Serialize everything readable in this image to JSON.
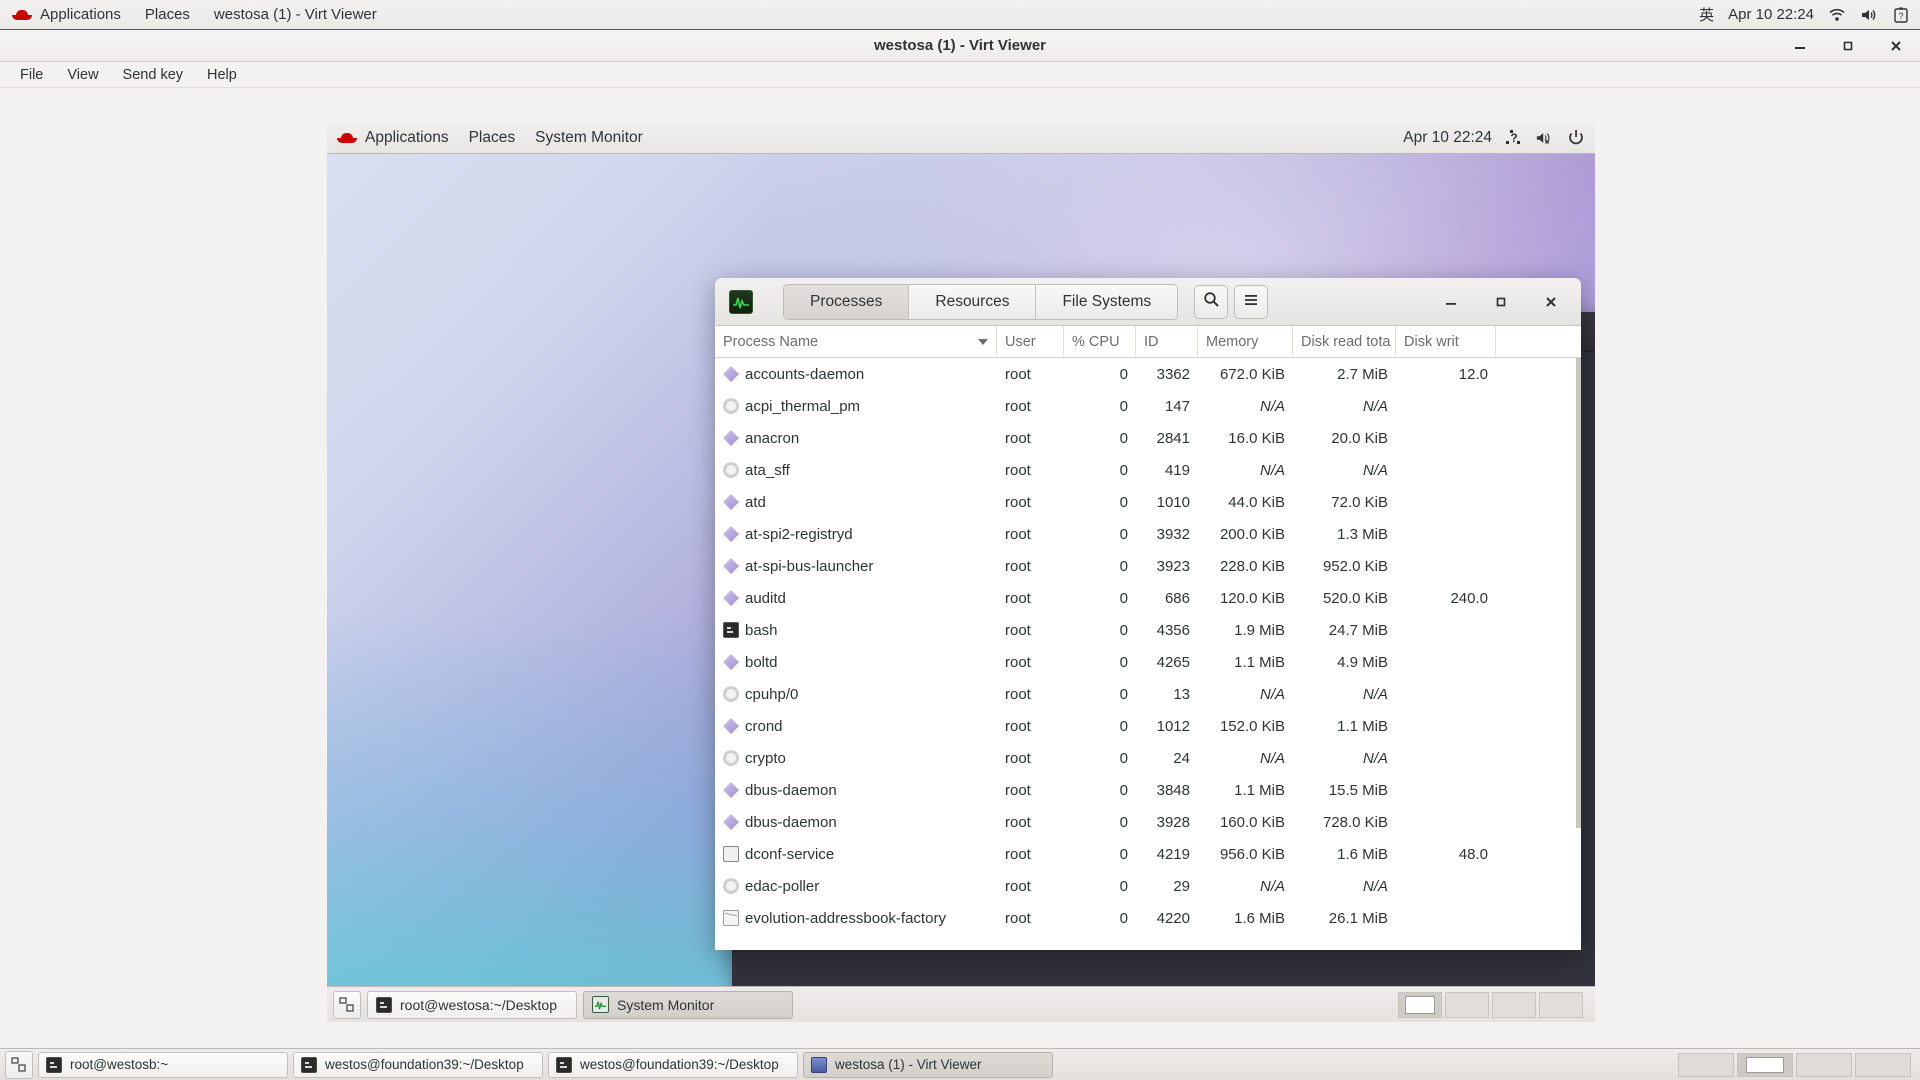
{
  "host_panel": {
    "logo_icon": "redhat-logo-icon",
    "applications_label": "Applications",
    "places_label": "Places",
    "window_title": "westosa (1) - Virt Viewer",
    "input_method": "英",
    "clock": "Apr 10  22:24",
    "wifi_icon": "wifi-icon",
    "volume_icon": "volume-icon",
    "battery_icon": "battery-icon"
  },
  "virt_viewer": {
    "title": "westosa (1) - Virt Viewer",
    "menu": [
      "File",
      "View",
      "Send key",
      "Help"
    ],
    "window_buttons": {
      "minimize": "—",
      "maximize": "□",
      "close": "✕"
    }
  },
  "vm_panel": {
    "logo_icon": "redhat-logo-icon",
    "applications_label": "Applications",
    "places_label": "Places",
    "app_label": "System Monitor",
    "clock": "Apr 10  22:24",
    "help_icon": "help-icon",
    "volume_muted_icon": "volume-muted-icon",
    "power_icon": "power-icon"
  },
  "system_monitor": {
    "app_icon": "system-monitor-icon",
    "tabs": [
      {
        "label": "Processes",
        "active": true
      },
      {
        "label": "Resources",
        "active": false
      },
      {
        "label": "File Systems",
        "active": false
      }
    ],
    "search_icon": "search-icon",
    "menu_icon": "hamburger-menu-icon",
    "window_buttons": {
      "minimize": "—",
      "maximize": "□",
      "close": "✕"
    },
    "columns": [
      {
        "key": "name",
        "label": "Process Name",
        "sorted": true
      },
      {
        "key": "user",
        "label": "User"
      },
      {
        "key": "cpu",
        "label": "% CPU"
      },
      {
        "key": "id",
        "label": "ID"
      },
      {
        "key": "memory",
        "label": "Memory"
      },
      {
        "key": "disk_read",
        "label": "Disk read tota"
      },
      {
        "key": "disk_write",
        "label": "Disk writ"
      }
    ],
    "rows": [
      {
        "icon": "diamond",
        "name": "accounts-daemon",
        "user": "root",
        "cpu": "0",
        "id": "3362",
        "memory": "672.0 KiB",
        "disk_read": "2.7 MiB",
        "disk_write": "12.0"
      },
      {
        "icon": "gear",
        "name": "acpi_thermal_pm",
        "user": "root",
        "cpu": "0",
        "id": "147",
        "memory": "N/A",
        "disk_read": "N/A",
        "disk_write": ""
      },
      {
        "icon": "diamond",
        "name": "anacron",
        "user": "root",
        "cpu": "0",
        "id": "2841",
        "memory": "16.0 KiB",
        "disk_read": "20.0 KiB",
        "disk_write": ""
      },
      {
        "icon": "gear",
        "name": "ata_sff",
        "user": "root",
        "cpu": "0",
        "id": "419",
        "memory": "N/A",
        "disk_read": "N/A",
        "disk_write": ""
      },
      {
        "icon": "diamond",
        "name": "atd",
        "user": "root",
        "cpu": "0",
        "id": "1010",
        "memory": "44.0 KiB",
        "disk_read": "72.0 KiB",
        "disk_write": ""
      },
      {
        "icon": "diamond",
        "name": "at-spi2-registryd",
        "user": "root",
        "cpu": "0",
        "id": "3932",
        "memory": "200.0 KiB",
        "disk_read": "1.3 MiB",
        "disk_write": ""
      },
      {
        "icon": "diamond",
        "name": "at-spi-bus-launcher",
        "user": "root",
        "cpu": "0",
        "id": "3923",
        "memory": "228.0 KiB",
        "disk_read": "952.0 KiB",
        "disk_write": ""
      },
      {
        "icon": "diamond",
        "name": "auditd",
        "user": "root",
        "cpu": "0",
        "id": "686",
        "memory": "120.0 KiB",
        "disk_read": "520.0 KiB",
        "disk_write": "240.0"
      },
      {
        "icon": "terminal",
        "name": "bash",
        "user": "root",
        "cpu": "0",
        "id": "4356",
        "memory": "1.9 MiB",
        "disk_read": "24.7 MiB",
        "disk_write": ""
      },
      {
        "icon": "diamond",
        "name": "boltd",
        "user": "root",
        "cpu": "0",
        "id": "4265",
        "memory": "1.1 MiB",
        "disk_read": "4.9 MiB",
        "disk_write": ""
      },
      {
        "icon": "gear",
        "name": "cpuhp/0",
        "user": "root",
        "cpu": "0",
        "id": "13",
        "memory": "N/A",
        "disk_read": "N/A",
        "disk_write": ""
      },
      {
        "icon": "diamond",
        "name": "crond",
        "user": "root",
        "cpu": "0",
        "id": "1012",
        "memory": "152.0 KiB",
        "disk_read": "1.1 MiB",
        "disk_write": ""
      },
      {
        "icon": "gear",
        "name": "crypto",
        "user": "root",
        "cpu": "0",
        "id": "24",
        "memory": "N/A",
        "disk_read": "N/A",
        "disk_write": ""
      },
      {
        "icon": "diamond",
        "name": "dbus-daemon",
        "user": "root",
        "cpu": "0",
        "id": "3848",
        "memory": "1.1 MiB",
        "disk_read": "15.5 MiB",
        "disk_write": ""
      },
      {
        "icon": "diamond",
        "name": "dbus-daemon",
        "user": "root",
        "cpu": "0",
        "id": "3928",
        "memory": "160.0 KiB",
        "disk_read": "728.0 KiB",
        "disk_write": ""
      },
      {
        "icon": "dconf",
        "name": "dconf-service",
        "user": "root",
        "cpu": "0",
        "id": "4219",
        "memory": "956.0 KiB",
        "disk_read": "1.6 MiB",
        "disk_write": "48.0"
      },
      {
        "icon": "gear",
        "name": "edac-poller",
        "user": "root",
        "cpu": "0",
        "id": "29",
        "memory": "N/A",
        "disk_read": "N/A",
        "disk_write": ""
      },
      {
        "icon": "mail",
        "name": "evolution-addressbook-factory",
        "user": "root",
        "cpu": "0",
        "id": "4220",
        "memory": "1.6 MiB",
        "disk_read": "26.1 MiB",
        "disk_write": ""
      }
    ]
  },
  "vm_terminal": {
    "window_buttons": {
      "minimize": "—",
      "maximize": "□",
      "close": "✕"
    }
  },
  "vm_taskbar": {
    "show_desktop_icon": "show-desktop-icon",
    "items": [
      {
        "icon": "terminal-icon",
        "label": "root@westosa:~/Desktop",
        "active": false
      },
      {
        "icon": "system-monitor-icon",
        "label": "System Monitor",
        "active": true
      }
    ],
    "workspaces": [
      {
        "active": true
      },
      {
        "active": false
      },
      {
        "active": false
      },
      {
        "active": false
      }
    ]
  },
  "host_taskbar": {
    "show_desktop_icon": "show-desktop-icon",
    "items": [
      {
        "icon": "terminal-icon",
        "label": "root@westosb:~",
        "active": false
      },
      {
        "icon": "terminal-icon",
        "label": "westos@foundation39:~/Desktop",
        "active": false
      },
      {
        "icon": "terminal-icon",
        "label": "westos@foundation39:~/Desktop",
        "active": false
      },
      {
        "icon": "virt-viewer-icon",
        "label": "westosa (1) - Virt Viewer",
        "active": true
      }
    ],
    "workspaces": [
      {
        "active": false
      },
      {
        "active": true
      },
      {
        "active": false
      },
      {
        "active": false
      }
    ]
  },
  "colors": {
    "accent": "#cc0000",
    "panel_bg": "#f2f1f0",
    "terminal_bg": "#2b2b33"
  }
}
